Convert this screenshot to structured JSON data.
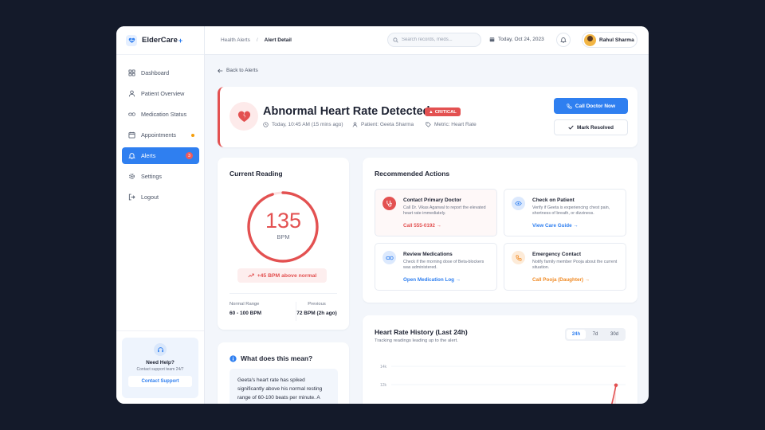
{
  "brand": {
    "name": "ElderCare",
    "plus": "+"
  },
  "sidebar": {
    "items": [
      {
        "label": "Dashboard"
      },
      {
        "label": "Patient Overview"
      },
      {
        "label": "Medication Status"
      },
      {
        "label": "Appointments"
      },
      {
        "label": "Alerts",
        "badge": "3"
      },
      {
        "label": "Settings"
      },
      {
        "label": "Logout"
      }
    ],
    "help": {
      "title": "Need Help?",
      "subtitle": "Contact support team 24/7",
      "button": "Contact Support"
    }
  },
  "topbar": {
    "breadcrumb": [
      "Health Alerts",
      "Alert Detail"
    ],
    "search_placeholder": "Search records, meds...",
    "date": "Today, Oct 24, 2023",
    "user_name": "Rahul Sharma"
  },
  "back_link": "Back to Alerts",
  "alert": {
    "title": "Abnormal Heart Rate Detected",
    "severity": "CRITICAL",
    "time": "Today, 10:45 AM (15 mins ago)",
    "patient": "Patient: Geeta Sharma",
    "metric": "Metric: Heart Rate",
    "call_button": "Call Doctor Now",
    "resolve_button": "Mark Resolved"
  },
  "reading": {
    "title": "Current Reading",
    "value": "135",
    "unit": "BPM",
    "gauge_fraction": 0.95,
    "delta": "+45 BPM above normal",
    "normal_label": "Normal Range",
    "normal_value": "60 - 100 BPM",
    "previous_label": "Previous",
    "previous_value": "72 BPM (2h ago)"
  },
  "explanation": {
    "title": "What does this mean?",
    "text": "Geeta's heart rate has spiked significantly above his normal resting range of 60-100 beats per minute. A"
  },
  "actions": {
    "title": "Recommended Actions",
    "items": [
      {
        "title": "Contact Primary Doctor",
        "desc": "Call Dr. Vikas Agarwal to report the elevated heart rate immediately.",
        "link": "Call 555-0192 →",
        "color": "#e35151"
      },
      {
        "title": "Check on Patient",
        "desc": "Verify if Geeta is experiencing chest pain, shortness of breath, or dizziness.",
        "link": "View Care Guide →",
        "color": "#2f7ff0"
      },
      {
        "title": "Review Medications",
        "desc": "Check if the morning dose of Beta-blockers was administered.",
        "link": "Open Medication Log →",
        "color": "#2f7ff0"
      },
      {
        "title": "Emergency Contact",
        "desc": "Notify family member Pooja about the current situation.",
        "link": "Call Pooja (Daughter) →",
        "color": "#f08a24"
      }
    ]
  },
  "history": {
    "title": "Heart Rate History (Last 24h)",
    "subtitle": "Tracking readings leading up to the alert.",
    "ranges": [
      "24h",
      "7d",
      "30d"
    ],
    "active_range": "24h"
  },
  "chart_data": {
    "type": "line",
    "ytick_labels": [
      "14k",
      "12k"
    ],
    "ylim": [
      100,
      145
    ],
    "series": [
      {
        "values": [
          135
        ]
      }
    ],
    "color": "#e35151"
  }
}
